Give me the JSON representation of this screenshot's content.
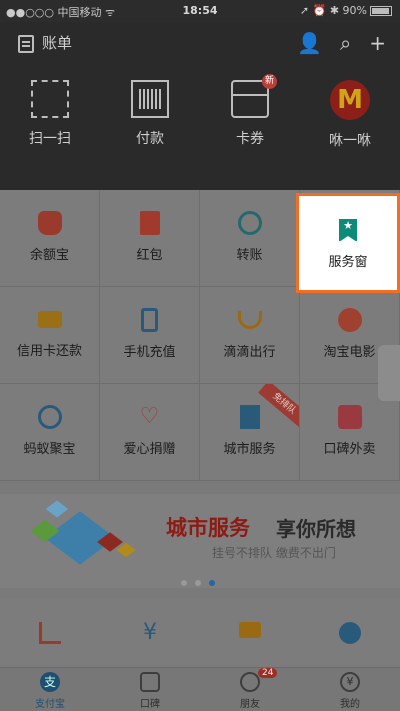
{
  "status": {
    "carrier": "中国移动",
    "time": "18:54",
    "battery": "90%"
  },
  "header": {
    "bill_label": "账单",
    "quick": [
      {
        "label": "扫一扫",
        "icon": "scan-icon"
      },
      {
        "label": "付款",
        "icon": "barcode-icon"
      },
      {
        "label": "卡券",
        "icon": "card-wallet-icon",
        "badge": "新"
      },
      {
        "label": "咻一咻",
        "icon": "mcdonalds-logo-icon"
      }
    ]
  },
  "grid": [
    {
      "label": "余额宝"
    },
    {
      "label": "红包"
    },
    {
      "label": "转账"
    },
    {
      "label": "服务窗"
    },
    {
      "label": "信用卡还款"
    },
    {
      "label": "手机充值"
    },
    {
      "label": "滴滴出行"
    },
    {
      "label": "淘宝电影"
    },
    {
      "label": "蚂蚁聚宝"
    },
    {
      "label": "爱心捐赠"
    },
    {
      "label": "城市服务"
    },
    {
      "label": "口碑外卖"
    }
  ],
  "ribbon": "免排队",
  "banner": {
    "title_red": "城市服务",
    "title_dark": "享你所想",
    "subtitle": "挂号不排队 缴费不出门"
  },
  "tabs": [
    {
      "label": "支付宝"
    },
    {
      "label": "口碑"
    },
    {
      "label": "朋友",
      "badge": "24"
    },
    {
      "label": "我的"
    }
  ],
  "colors": {
    "highlight_border": "#f26e22",
    "service_icon": "#0c8c78",
    "active_tab": "#1e4e72"
  }
}
